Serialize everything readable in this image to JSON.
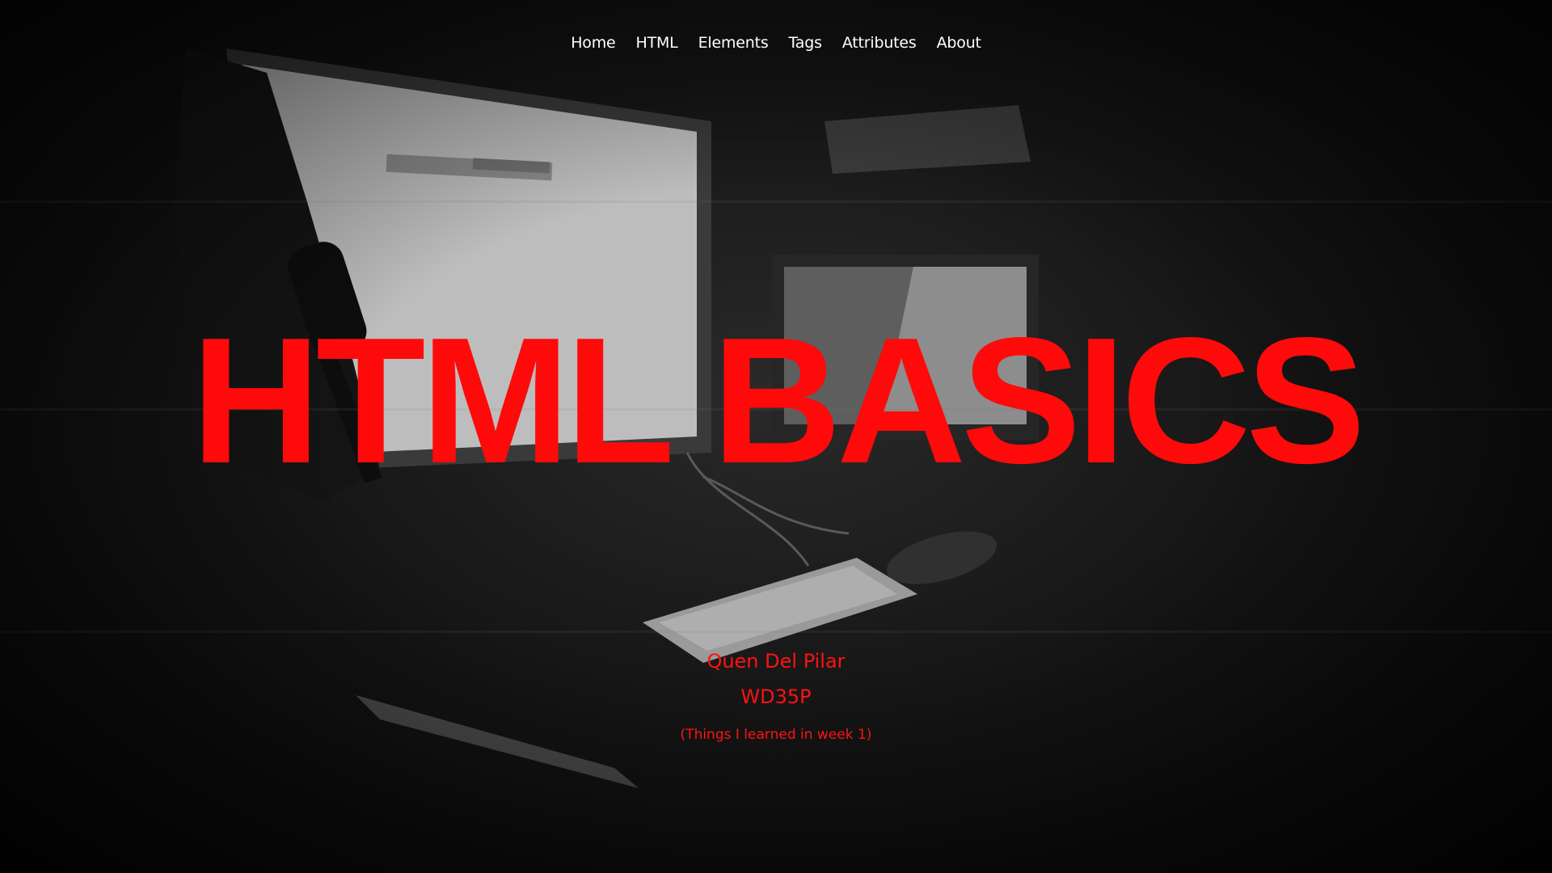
{
  "nav": {
    "items": [
      {
        "label": "Home"
      },
      {
        "label": "HTML"
      },
      {
        "label": "Elements"
      },
      {
        "label": "Tags"
      },
      {
        "label": "Attributes"
      },
      {
        "label": "About"
      }
    ]
  },
  "hero": {
    "title": "HTML BASICS",
    "author": "Quen Del Pilar",
    "code": "WD35P",
    "note": "(Things I learned in week 1)"
  },
  "colors": {
    "accent": "#ff0a0a",
    "nav_text": "#ffffff",
    "background": "#111111"
  }
}
